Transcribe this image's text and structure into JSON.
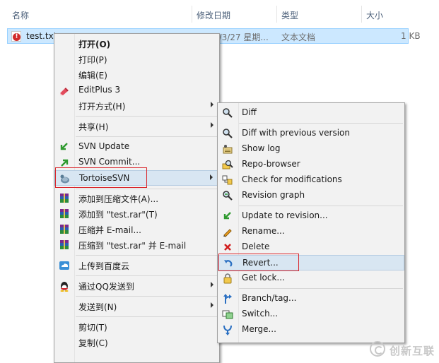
{
  "columns": {
    "name": "名称",
    "modified": "修改日期",
    "type": "类型",
    "size": "大小"
  },
  "file": {
    "name": "test.txt",
    "modified": "2013/3/27 星期...",
    "type": "文本文档",
    "size": "1 KB"
  },
  "menu1": {
    "items": [
      {
        "label": "打开(O)",
        "icon": ""
      },
      {
        "label": "打印(P)",
        "icon": ""
      },
      {
        "label": "编辑(E)",
        "icon": ""
      },
      {
        "label": "EditPlus 3",
        "icon": "editplus-icon"
      },
      {
        "label": "打开方式(H)",
        "icon": ""
      },
      {
        "label": "共享(H)",
        "icon": ""
      },
      {
        "label": "SVN Update",
        "icon": "svn-update-icon"
      },
      {
        "label": "SVN Commit...",
        "icon": "svn-commit-icon"
      },
      {
        "label": "TortoiseSVN",
        "icon": "tortoisesvn-icon"
      },
      {
        "label": "添加到压缩文件(A)...",
        "icon": "winrar-icon"
      },
      {
        "label": "添加到 \"test.rar\"(T)",
        "icon": "winrar-icon"
      },
      {
        "label": "压缩并 E-mail...",
        "icon": "winrar-icon"
      },
      {
        "label": "压缩到 \"test.rar\" 并 E-mail",
        "icon": "winrar-icon"
      },
      {
        "label": "上传到百度云",
        "icon": "baidu-cloud-icon"
      },
      {
        "label": "通过QQ发送到",
        "icon": "qq-icon"
      },
      {
        "label": "发送到(N)",
        "icon": ""
      },
      {
        "label": "剪切(T)",
        "icon": ""
      },
      {
        "label": "复制(C)",
        "icon": ""
      }
    ]
  },
  "menu2": {
    "items": [
      {
        "label": "Diff",
        "icon": "diff-icon"
      },
      {
        "label": "Diff with previous version",
        "icon": "diff-previous-icon"
      },
      {
        "label": "Show log",
        "icon": "show-log-icon"
      },
      {
        "label": "Repo-browser",
        "icon": "repo-browser-icon"
      },
      {
        "label": "Check for modifications",
        "icon": "check-modifications-icon"
      },
      {
        "label": "Revision graph",
        "icon": "revision-graph-icon"
      },
      {
        "label": "Update to revision...",
        "icon": "update-revision-icon"
      },
      {
        "label": "Rename...",
        "icon": "rename-icon"
      },
      {
        "label": "Delete",
        "icon": "delete-icon"
      },
      {
        "label": "Revert...",
        "icon": "revert-icon"
      },
      {
        "label": "Get lock...",
        "icon": "lock-icon"
      },
      {
        "label": "Branch/tag...",
        "icon": "branch-icon"
      },
      {
        "label": "Switch...",
        "icon": "switch-icon"
      },
      {
        "label": "Merge...",
        "icon": "merge-icon"
      }
    ]
  },
  "watermark": {
    "text": "创新互联"
  },
  "colors": {
    "selection": "#cce8ff",
    "menu_bg": "#f2f2f2",
    "highlight": "#d8e6f2",
    "callout": "#d9262c"
  }
}
